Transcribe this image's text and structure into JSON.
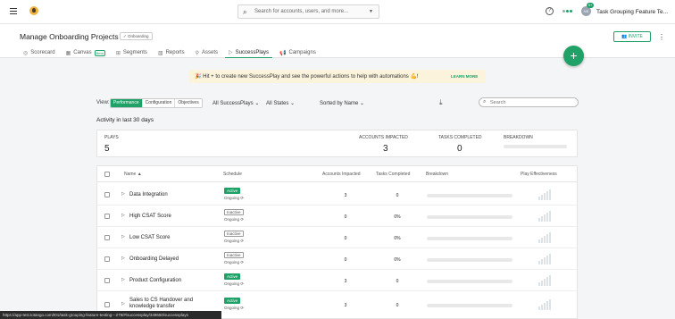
{
  "topbar": {
    "search_placeholder": "Search for accounts, users, and more...",
    "avatar_initials": "NS",
    "avatar_badge": "9+",
    "user_name": "Task Grouping Feature Te..."
  },
  "header": {
    "title": "Manage Onboarding Projects",
    "badge": "Onboarding",
    "invite_label": "INVITE",
    "tabs": [
      {
        "label": "Scorecard",
        "icon": "scorecard-icon"
      },
      {
        "label": "Canvas",
        "icon": "canvas-icon",
        "badge": "Beta"
      },
      {
        "label": "Segments",
        "icon": "segments-icon"
      },
      {
        "label": "Reports",
        "icon": "reports-icon"
      },
      {
        "label": "Assets",
        "icon": "assets-icon"
      },
      {
        "label": "SuccessPlays",
        "icon": "play-icon",
        "active": true
      },
      {
        "label": "Campaigns",
        "icon": "campaigns-icon"
      }
    ]
  },
  "banner": {
    "text": "Hit + to create new SuccessPlay and see the powerful actions to help with automations 💪!",
    "link": "LEARN MORE"
  },
  "filters": {
    "view_label": "View:",
    "view_options": [
      "Performance",
      "Configuration",
      "Objectives"
    ],
    "successplays": "All SuccessPlays",
    "states": "All States",
    "sort": "Sorted by Name",
    "search_placeholder": "Search"
  },
  "activity_title": "Activity in last 30 days",
  "summary": {
    "plays_label": "PLAYS",
    "plays": "5",
    "accounts_label": "ACCOUNTS IMPACTED",
    "accounts": "3",
    "tasks_label": "TASKS COMPLETED",
    "tasks": "0",
    "breakdown_label": "BREAKDOWN"
  },
  "table": {
    "columns": {
      "name": "Name ▲",
      "schedule": "Schedule",
      "accounts": "Accounts Impacted",
      "tasks": "Tasks Completed",
      "breakdown": "Breakdown",
      "effectiveness": "Play Effectiveness"
    },
    "rows": [
      {
        "name": "Data Integration",
        "status": "Active",
        "schedule": "Ongoing",
        "accounts": "3",
        "tasks": "0"
      },
      {
        "name": "High CSAT Score",
        "status": "Inactive",
        "schedule": "Ongoing",
        "accounts": "0",
        "tasks": "0%"
      },
      {
        "name": "Low CSAT Score",
        "status": "Inactive",
        "schedule": "Ongoing",
        "accounts": "0",
        "tasks": "0%"
      },
      {
        "name": "Onboarding Delayed",
        "status": "Inactive",
        "schedule": "Ongoing",
        "accounts": "0",
        "tasks": "0%"
      },
      {
        "name": "Product Configuration",
        "status": "Active",
        "schedule": "Ongoing",
        "accounts": "3",
        "tasks": "0"
      },
      {
        "name": "Sales to CS Handover and knowledge transfer",
        "status": "Active",
        "schedule": "Ongoing",
        "accounts": "3",
        "tasks": "0"
      }
    ]
  },
  "statusbar_url": "https://app-test.totango.com/t01/task-grouping-feature-testing---279/#/successplay/349650/successplays",
  "colors": {
    "accent": "#1fa167",
    "banner_bg": "#fbf3dc"
  }
}
